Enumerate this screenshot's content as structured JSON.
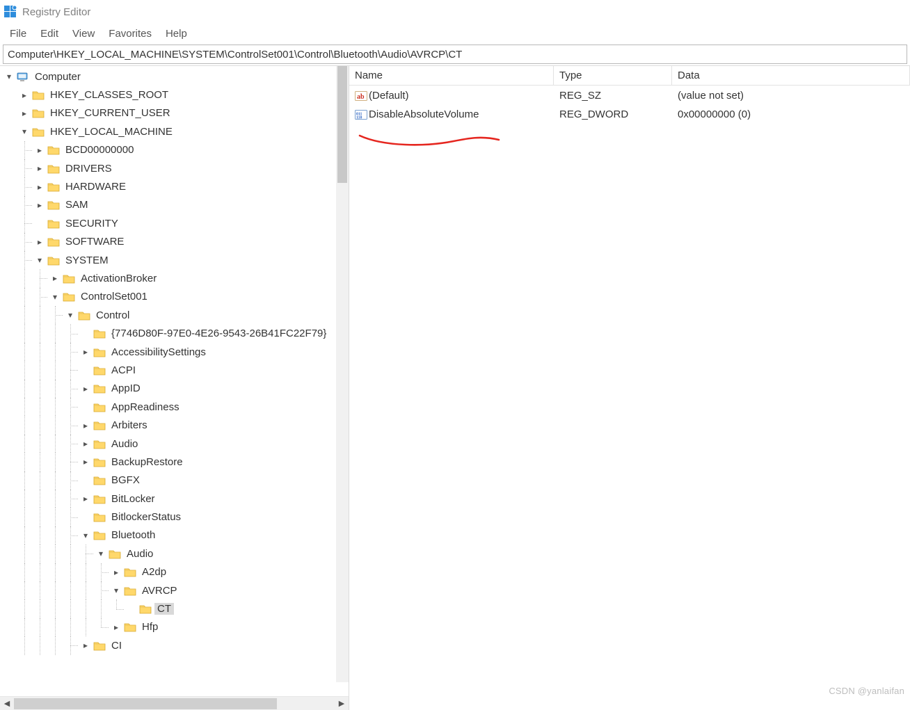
{
  "window_title": "Registry Editor",
  "menubar": {
    "file": "File",
    "edit": "Edit",
    "view": "View",
    "favorites": "Favorites",
    "help": "Help"
  },
  "address": "Computer\\HKEY_LOCAL_MACHINE\\SYSTEM\\ControlSet001\\Control\\Bluetooth\\Audio\\AVRCP\\CT",
  "tree": {
    "root": "Computer",
    "hives": {
      "hkcr": "HKEY_CLASSES_ROOT",
      "hkcu": "HKEY_CURRENT_USER",
      "hklm": "HKEY_LOCAL_MACHINE"
    },
    "hklm_children": {
      "bcd": "BCD00000000",
      "drivers": "DRIVERS",
      "hardware": "HARDWARE",
      "sam": "SAM",
      "security": "SECURITY",
      "software": "SOFTWARE",
      "system": "SYSTEM"
    },
    "system_children": {
      "activationbroker": "ActivationBroker",
      "controlset001": "ControlSet001"
    },
    "control": "Control",
    "control_children": {
      "guid": "{7746D80F-97E0-4E26-9543-26B41FC22F79}",
      "accessibility": "AccessibilitySettings",
      "acpi": "ACPI",
      "appid": "AppID",
      "appreadiness": "AppReadiness",
      "arbiters": "Arbiters",
      "audio": "Audio",
      "backuprestore": "BackupRestore",
      "bgfx": "BGFX",
      "bitlocker": "BitLocker",
      "bitlockerstatus": "BitlockerStatus",
      "bluetooth": "Bluetooth"
    },
    "bluetooth_audio": "Audio",
    "bt_audio_children": {
      "a2dp": "A2dp",
      "avrcp": "AVRCP",
      "hfp": "Hfp"
    },
    "avrcp_ct": "CT",
    "ci": "CI"
  },
  "list": {
    "columns": {
      "name": "Name",
      "type": "Type",
      "data": "Data"
    },
    "rows": [
      {
        "icon": "string",
        "name": "(Default)",
        "type": "REG_SZ",
        "data": "(value not set)"
      },
      {
        "icon": "binary",
        "name": "DisableAbsoluteVolume",
        "type": "REG_DWORD",
        "data": "0x00000000 (0)"
      }
    ]
  },
  "watermark": "CSDN @yanlaifan"
}
